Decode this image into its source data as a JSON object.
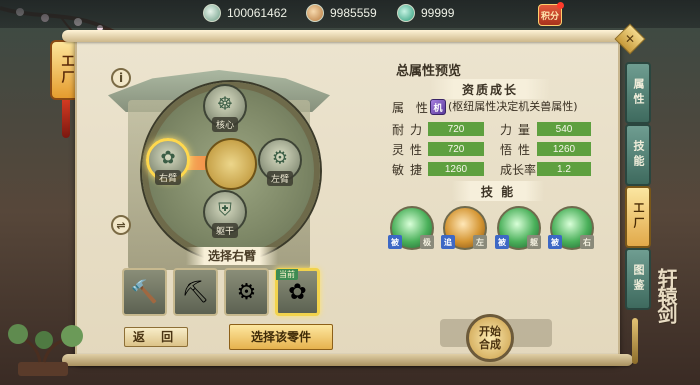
{
  "resources": [
    {
      "name": "jade-coin",
      "value": "100061462",
      "color": "#6d9d86"
    },
    {
      "name": "copper-coin",
      "value": "9985559",
      "color": "#b7793d"
    },
    {
      "name": "green-coin",
      "value": "99999",
      "color": "#2c9c7a"
    }
  ],
  "top_badge": "积分",
  "left_tag": "工厂",
  "workshop": {
    "slots": [
      {
        "label": "核心",
        "glyph": "☸"
      },
      {
        "label": "右臂",
        "glyph": "✿"
      },
      {
        "label": "左臂",
        "glyph": "⚙"
      },
      {
        "label": "躯干",
        "glyph": "⛨"
      }
    ],
    "select_title": "选择右臂",
    "parts": [
      {
        "glyph": "🔨",
        "current": false
      },
      {
        "glyph": "⛏",
        "current": false
      },
      {
        "glyph": "⚙",
        "current": false
      },
      {
        "glyph": "✿",
        "current": true
      }
    ],
    "current_label": "当前",
    "back_label": "返 回",
    "select_label": "选择该零件"
  },
  "attributes": {
    "title": "总属性预览",
    "growth_header": "资质成长",
    "element_label": "属 性",
    "element_icon": "机",
    "element_note": "(枢纽属性决定机关兽属性)",
    "stats": [
      {
        "label": "耐力",
        "value": "720"
      },
      {
        "label": "力量",
        "value": "540"
      },
      {
        "label": "灵性",
        "value": "720"
      },
      {
        "label": "悟性",
        "value": "1260"
      },
      {
        "label": "敏捷",
        "value": "1260"
      },
      {
        "label": "成长率",
        "value": "1.2"
      }
    ],
    "skill_header": "技 能",
    "skills": [
      {
        "style": "green",
        "tags": [
          "被",
          "极"
        ]
      },
      {
        "style": "gold",
        "tags": [
          "追",
          "左"
        ]
      },
      {
        "style": "green",
        "tags": [
          "被",
          "躯"
        ]
      },
      {
        "style": "green",
        "tags": [
          "被",
          "右"
        ]
      }
    ],
    "start_line1": "开始",
    "start_line2": "合成"
  },
  "tabs": [
    {
      "label": "属性",
      "active": false
    },
    {
      "label": "技能",
      "active": false
    },
    {
      "label": "工厂",
      "active": true
    },
    {
      "label": "图鉴",
      "active": false
    }
  ],
  "logo": "轩辕剑",
  "close_icon": "✕",
  "info_icon": "i",
  "swap_icon": "⇌"
}
